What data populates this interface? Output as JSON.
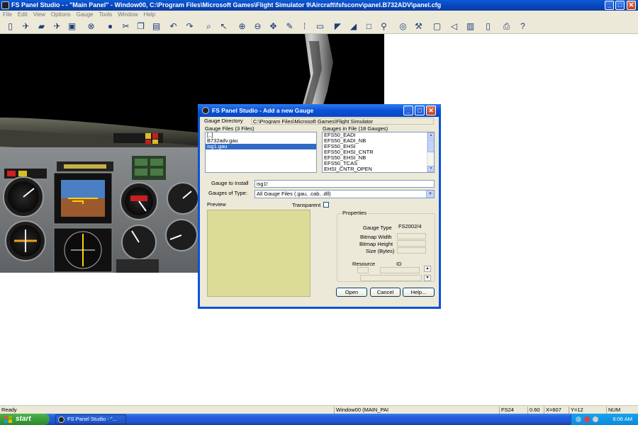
{
  "window": {
    "title": "FS Panel Studio - - \"Main Panel\" - Window00, C:\\Program Files\\Microsoft Games\\Flight Simulator 9\\Aircraft\\fsfsconv\\panel.B732ADV\\panel.cfg",
    "min_label": "_",
    "max_label": "□",
    "close_label": "✕"
  },
  "menu": [
    "File",
    "Edit",
    "View",
    "Options",
    "Gauge",
    "Tools",
    "Window",
    "Help"
  ],
  "toolbar": [
    {
      "name": "new-file-icon",
      "glyph": "▯"
    },
    {
      "name": "add-plane-icon",
      "glyph": "✈"
    },
    {
      "name": "open-folder-icon",
      "glyph": "▰"
    },
    {
      "name": "plane-icon",
      "glyph": "✈"
    },
    {
      "name": "save-icon",
      "glyph": "▣"
    },
    {
      "name": "stop-icon",
      "glyph": "⊗"
    },
    {
      "name": "sphere-icon",
      "glyph": "●"
    },
    {
      "name": "scissors-icon",
      "glyph": "✂"
    },
    {
      "name": "copy-icon",
      "glyph": "❐"
    },
    {
      "name": "paste-icon",
      "glyph": "▤"
    },
    {
      "name": "undo-icon",
      "glyph": "↶"
    },
    {
      "name": "redo-icon",
      "glyph": "↷"
    },
    {
      "name": "search-icon",
      "glyph": "⌕"
    },
    {
      "name": "pointer-icon",
      "glyph": "↖"
    },
    {
      "name": "zoom-in-icon",
      "glyph": "⊕"
    },
    {
      "name": "zoom-out-icon",
      "glyph": "⊖"
    },
    {
      "name": "move-icon",
      "glyph": "✥"
    },
    {
      "name": "brush-icon",
      "glyph": "✎"
    },
    {
      "name": "grid-icon",
      "glyph": "⁞"
    },
    {
      "name": "select-rect-icon",
      "glyph": "▭"
    },
    {
      "name": "corner-icon",
      "glyph": "◤"
    },
    {
      "name": "needle-icon",
      "glyph": "◢"
    },
    {
      "name": "note-icon",
      "glyph": "□"
    },
    {
      "name": "gauge-link-icon",
      "glyph": "⚲"
    },
    {
      "name": "compass-icon",
      "glyph": "◎"
    },
    {
      "name": "tools-icon",
      "glyph": "⚒"
    },
    {
      "name": "window-icon",
      "glyph": "▢"
    },
    {
      "name": "sound-icon",
      "glyph": "◁"
    },
    {
      "name": "image-icon",
      "glyph": "▥"
    },
    {
      "name": "document-icon",
      "glyph": "▯"
    },
    {
      "name": "print-icon",
      "glyph": "⎙"
    },
    {
      "name": "help-icon",
      "glyph": "?"
    }
  ],
  "dialog": {
    "title": "FS Panel Studio - Add a new Gauge",
    "gauge_directory_label": "Gauge Directory",
    "gauge_directory_value": "C:\\Program Files\\Microsoft Games\\Flight Simulator",
    "gauge_files_label": "Gauge Files  (3 Files)",
    "gauge_files": [
      "[..]",
      "B732adv.gau",
      "isg1.gau"
    ],
    "gauge_files_selected": 2,
    "gauges_in_file_label": "Gauges in File  (18 Gauges)",
    "gauges_in_file": [
      "EFS50_EADI",
      "EFS50_EADI_NB",
      "EFS50_EHSI",
      "EFS50_EHSI_CNTR",
      "EFS50_EHSI_NB",
      "EFS50_TCAS",
      "EHSI_CNTR_OPEN"
    ],
    "gauge_to_install_label": "Gauge to Install",
    "gauge_to_install_value": "isg1!",
    "gauges_of_type_label": "Gauges of Type:",
    "gauges_of_type_value": "All Gauge Files (.gau, .cab, .dll)",
    "preview_label": "Preview",
    "transparent_label": "Transparent",
    "properties_label": "Properties",
    "gauge_type_label": "Gauge Type",
    "gauge_type_value": "FS2002/4",
    "bitmap_width_label": "Bitmap Width",
    "bitmap_height_label": "Bitmap Height",
    "size_label": "Size (Bytes)",
    "resource_label": "Resource",
    "id_label": "ID",
    "open_label": "Open",
    "cancel_label": "Cancel",
    "help_label": "Help..."
  },
  "status": {
    "ready": "Ready",
    "window": "Window00 (MAIN_PAI",
    "fs": "FS24",
    "zoom": "0.60",
    "x": "X=607",
    "y": "Y=12",
    "num": "NUM"
  },
  "taskbar": {
    "start": "start",
    "task": "FS Panel Studio - \"...",
    "clock": "6:06 AM"
  }
}
